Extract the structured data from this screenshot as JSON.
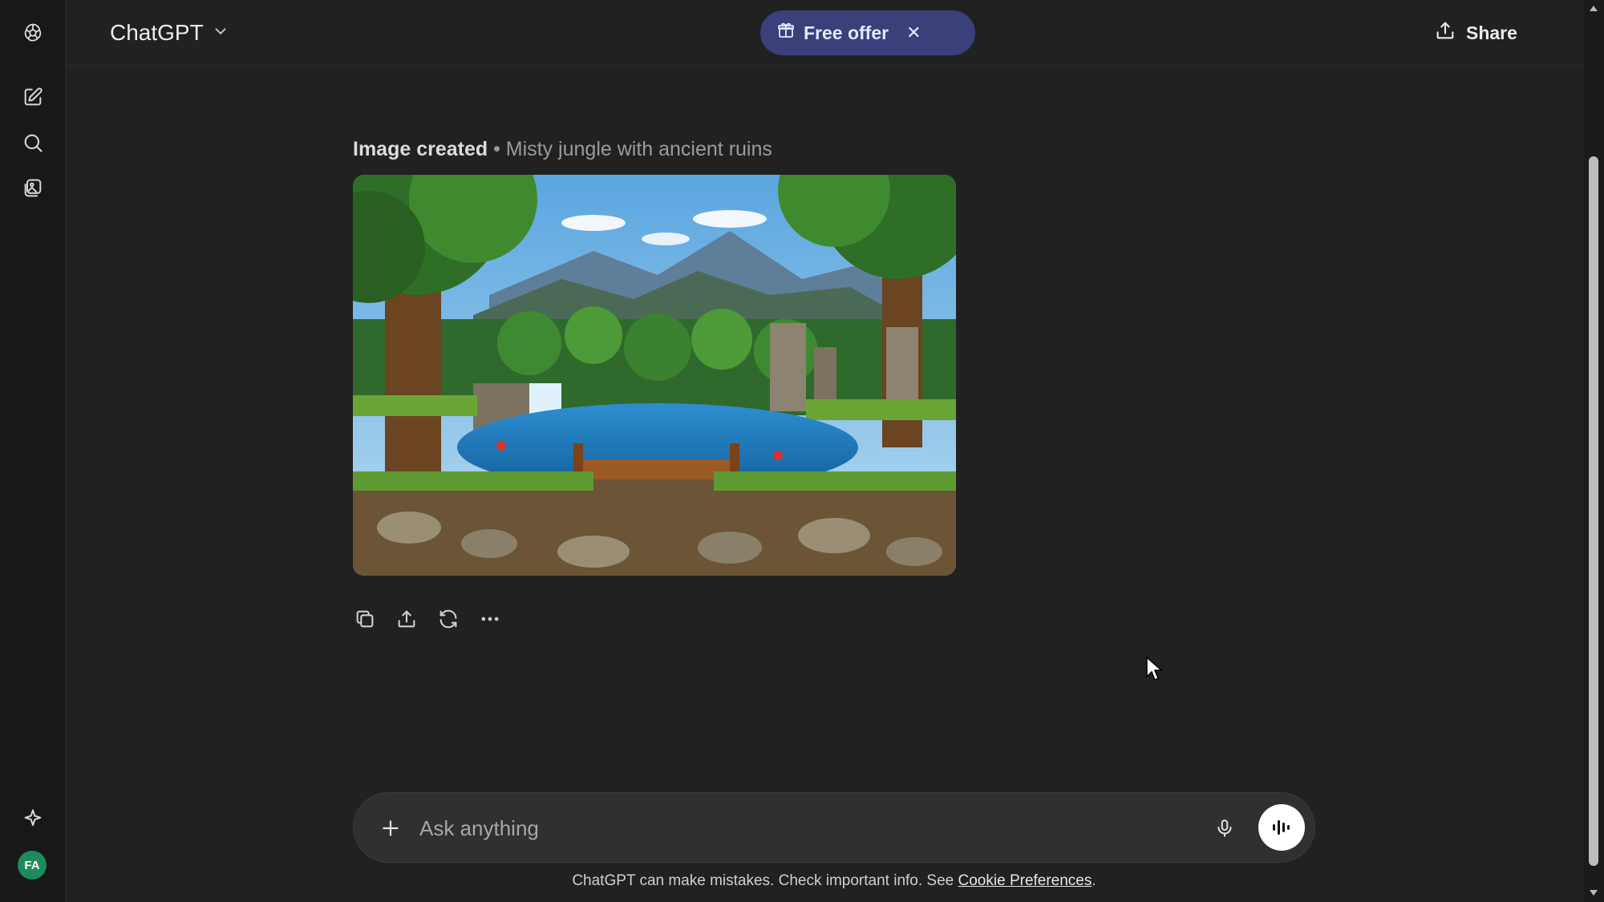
{
  "header": {
    "model_name": "ChatGPT",
    "offer_label": "Free offer",
    "share_label": "Share"
  },
  "message": {
    "caption_strong": "Image created",
    "caption_rest": " • Misty jungle with ancient ruins"
  },
  "composer": {
    "placeholder": "Ask anything"
  },
  "footer": {
    "text": "ChatGPT can make mistakes. Check important info. See ",
    "link": "Cookie Preferences",
    "end": "."
  },
  "user": {
    "initials": "FA"
  },
  "icons": {
    "logo": "openai-logo-icon",
    "new_chat": "new-chat-icon",
    "search": "search-icon",
    "library": "library-icon",
    "upgrade": "sparkle-icon"
  },
  "colors": {
    "background": "#212121",
    "offer_bg": "#3b3f7a",
    "avatar_bg": "#1f8a5b"
  }
}
